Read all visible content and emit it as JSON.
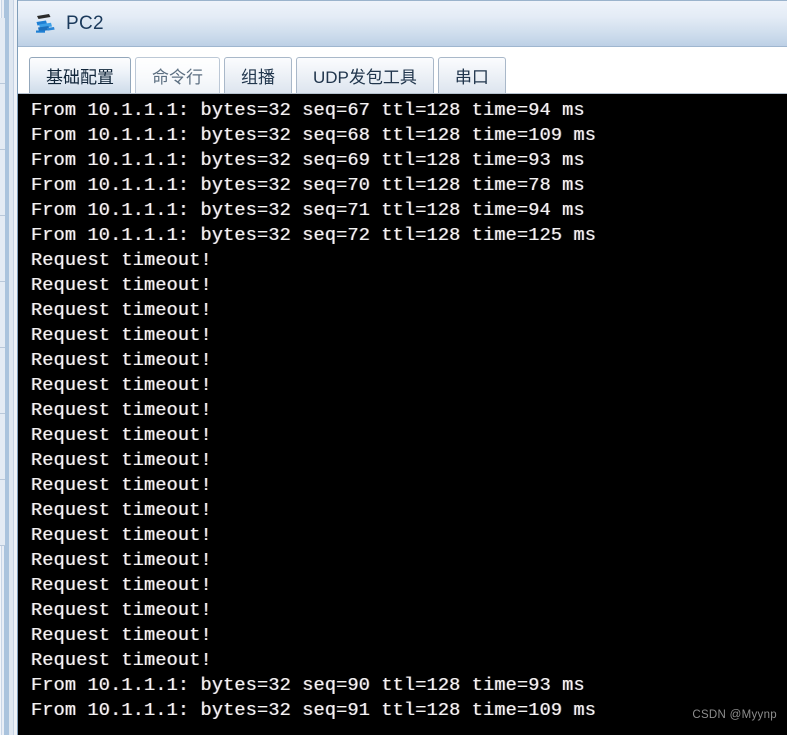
{
  "window": {
    "title": "PC2",
    "icon": "pc-device-icon"
  },
  "tabs": [
    {
      "label": "基础配置",
      "state": "active"
    },
    {
      "label": "命令行",
      "state": "pale"
    },
    {
      "label": "组播",
      "state": "normal"
    },
    {
      "label": "UDP发包工具",
      "state": "normal"
    },
    {
      "label": "串口",
      "state": "normal"
    }
  ],
  "terminal": {
    "lines": [
      "From 10.1.1.1: bytes=32 seq=67 ttl=128 time=94 ms",
      "From 10.1.1.1: bytes=32 seq=68 ttl=128 time=109 ms",
      "From 10.1.1.1: bytes=32 seq=69 ttl=128 time=93 ms",
      "From 10.1.1.1: bytes=32 seq=70 ttl=128 time=78 ms",
      "From 10.1.1.1: bytes=32 seq=71 ttl=128 time=94 ms",
      "From 10.1.1.1: bytes=32 seq=72 ttl=128 time=125 ms",
      "Request timeout!",
      "Request timeout!",
      "Request timeout!",
      "Request timeout!",
      "Request timeout!",
      "Request timeout!",
      "Request timeout!",
      "Request timeout!",
      "Request timeout!",
      "Request timeout!",
      "Request timeout!",
      "Request timeout!",
      "Request timeout!",
      "Request timeout!",
      "Request timeout!",
      "Request timeout!",
      "Request timeout!",
      "From 10.1.1.1: bytes=32 seq=90 ttl=128 time=93 ms",
      "From 10.1.1.1: bytes=32 seq=91 ttl=128 time=109 ms"
    ]
  },
  "watermark": {
    "text": "CSDN @Myynp"
  },
  "colors": {
    "titlebar_top": "#eef3fa",
    "titlebar_bottom": "#bdd0e6",
    "terminal_bg": "#000000",
    "terminal_text": "#f4f4f4",
    "title_text": "#1b3a5c"
  }
}
